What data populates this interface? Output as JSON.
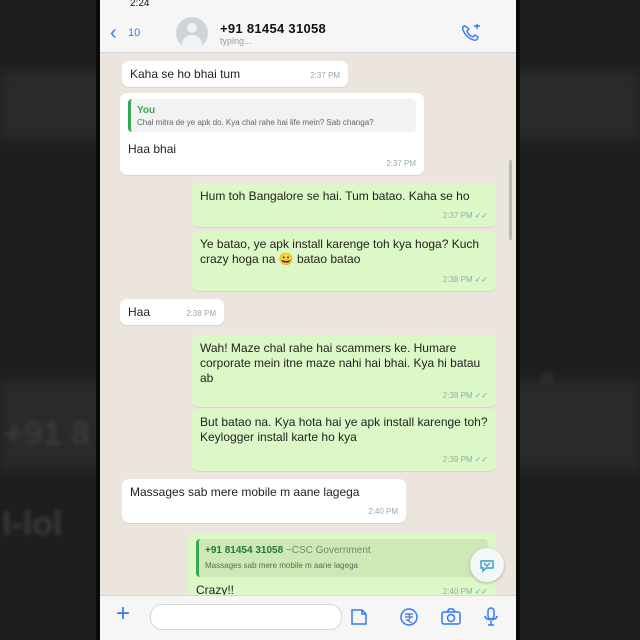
{
  "status_bar": {
    "time": "2:24"
  },
  "header": {
    "back_count": "10",
    "contact_name": "+91 81454 31058",
    "subtitle": "typing..."
  },
  "messages": [
    {
      "dir": "in",
      "text": "Kaha se ho bhai tum",
      "time": "2:37 PM"
    },
    {
      "dir": "in",
      "quote": {
        "name": "You",
        "text": "Chal mitra de ye apk do. Kya chal rahe hai life mein? Sab changa?"
      },
      "text": "Haa bhai",
      "time": "2:37 PM"
    },
    {
      "dir": "out",
      "text": "Hum toh Bangalore se hai. Tum batao. Kaha se ho",
      "time": "2:37 PM"
    },
    {
      "dir": "out",
      "text": "Ye batao, ye apk install karenge toh kya hoga? Kuch crazy hoga na 😀 batao batao",
      "time": "2:38 PM"
    },
    {
      "dir": "in",
      "text": "Haa",
      "time": "2:38 PM"
    },
    {
      "dir": "out",
      "text": "Wah! Maze chal rahe hai scammers ke. Humare corporate mein itne maze nahi hai bhai. Kya hi batau ab",
      "time": "2:38 PM"
    },
    {
      "dir": "out",
      "text": "But batao na. Kya hota hai ye apk install karenge toh? Keylogger install karte ho kya",
      "time": "2:39 PM"
    },
    {
      "dir": "in",
      "text": "Massages sab mere mobile m aane lagega",
      "time": "2:40 PM"
    },
    {
      "dir": "out",
      "quote": {
        "name": "+91 81454 31058",
        "sub": "~CSC Government",
        "text": "Massages sab mere mobile m aane lagega"
      },
      "text": "Crazy!!",
      "time": "2:40 PM"
    }
  ],
  "icons": {
    "back": "chevron-left-icon",
    "avatar": "person-icon",
    "call": "phone-icon",
    "attach": "plus-icon",
    "sticker": "sticker-icon",
    "payment": "rupee-icon",
    "camera": "camera-icon",
    "mic": "mic-icon",
    "scroll_down": "scroll-down-icon"
  },
  "colors": {
    "incoming": "#ffffff",
    "outgoing": "#dcf8c6",
    "chat_bg": "#ece5dd",
    "accent": "#3478f6"
  }
}
